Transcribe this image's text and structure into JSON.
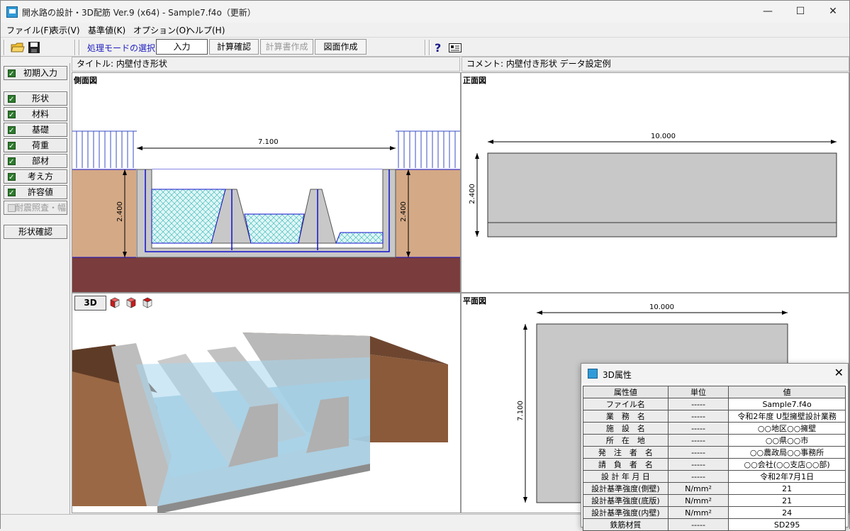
{
  "window": {
    "title": "開水路の設計・3D配筋 Ver.9 (x64) - Sample7.f4o（更新）",
    "minimize": "—",
    "maximize": "☐",
    "close": "✕"
  },
  "menu": [
    "ファイル(F)",
    "表示(V)",
    "基準値(K)",
    "オプション(O)",
    "ヘルプ(H)"
  ],
  "toolbar": {
    "mode_label": "処理モードの選択",
    "buttons": [
      "入力",
      "計算確認",
      "計算書作成",
      "図面作成"
    ]
  },
  "info": {
    "title": "タイトル: 内壁付き形状",
    "comment": "コメント: 内壁付き形状  データ設定例"
  },
  "sidebar": {
    "initial": "初期入力",
    "items": [
      "形状",
      "材料",
      "基礎",
      "荷重",
      "部材",
      "考え方",
      "許容値"
    ],
    "disabled": "耐震照査・幅",
    "confirm": "形状確認"
  },
  "panes": {
    "side_view": {
      "label": "側面図",
      "dim_width": "7.100",
      "dim_height_left": "2.400",
      "dim_height_right": "2.400"
    },
    "front_view": {
      "label": "正面図",
      "dim_width": "10.000",
      "dim_height": "2.400"
    },
    "view3d": {
      "button": "3D"
    },
    "plan_view": {
      "label": "平面図",
      "dim_width": "10.000",
      "dim_height": "7.100"
    }
  },
  "dialog": {
    "title": "3D属性",
    "headers": [
      "属性値",
      "単位",
      "値"
    ],
    "rows": [
      [
        "ファイル名",
        "-----",
        "Sample7.f4o"
      ],
      [
        "業　務　名",
        "-----",
        "令和2年度 U型擁壁設計業務"
      ],
      [
        "施　設　名",
        "-----",
        "○○地区○○擁壁"
      ],
      [
        "所　在　地",
        "-----",
        "○○県○○市"
      ],
      [
        "発　注　者　名",
        "-----",
        "○○農政局○○事務所"
      ],
      [
        "請　負　者　名",
        "-----",
        "○○会社(○○支店○○部)"
      ],
      [
        "設 計 年 月 日",
        "-----",
        "令和2年7月1日"
      ],
      [
        "設計基準強度(側壁)",
        "N/mm²",
        "21"
      ],
      [
        "設計基準強度(底版)",
        "N/mm²",
        "21"
      ],
      [
        "設計基準強度(内壁)",
        "N/mm²",
        "24"
      ],
      [
        "鉄筋材質",
        "-----",
        "SD295"
      ]
    ]
  }
}
